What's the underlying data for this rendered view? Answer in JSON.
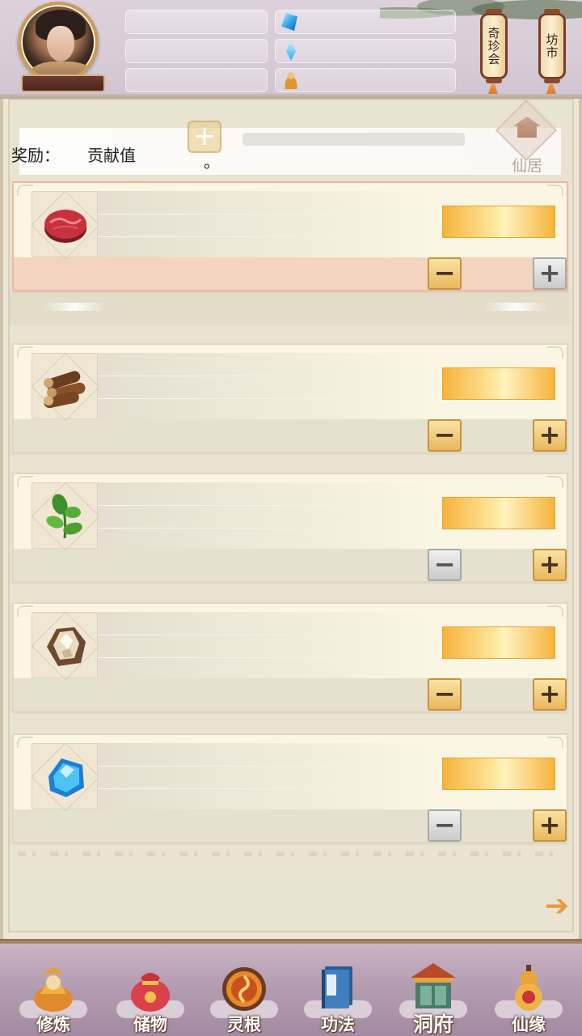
{
  "header": {
    "shortcuts": [
      {
        "label": "奇珍会"
      },
      {
        "label": "坊市"
      }
    ],
    "resources": [
      {
        "icon": "spirit-stone-icon"
      },
      {
        "icon": "spirit-crystal-icon"
      },
      {
        "icon": "cultivator-icon"
      }
    ]
  },
  "reward": {
    "label": "奖励：",
    "value": "贡献值",
    "suffix": "。",
    "home_label": "仙居"
  },
  "items": [
    {
      "name": "meat",
      "icon": "meat-icon",
      "selected": true,
      "minus_style": "gold",
      "plus_style": "grey"
    },
    {
      "name": "wood",
      "icon": "wood-logs-icon",
      "selected": false,
      "minus_style": "gold",
      "plus_style": "gold"
    },
    {
      "name": "herb",
      "icon": "herb-icon",
      "selected": false,
      "minus_style": "grey",
      "plus_style": "gold"
    },
    {
      "name": "ore",
      "icon": "ore-icon",
      "selected": false,
      "minus_style": "gold",
      "plus_style": "gold"
    },
    {
      "name": "crystal",
      "icon": "blue-crystal-icon",
      "selected": false,
      "minus_style": "grey",
      "plus_style": "gold"
    }
  ],
  "buttons": {
    "minus": "−",
    "plus": "+"
  },
  "nav": [
    {
      "label": "修炼",
      "icon": "meditation-icon"
    },
    {
      "label": "储物",
      "icon": "storage-bag-icon"
    },
    {
      "label": "灵根",
      "icon": "spirit-root-icon"
    },
    {
      "label": "功法",
      "icon": "technique-book-icon"
    },
    {
      "label": "洞府",
      "icon": "cave-dwelling-icon",
      "active": true
    },
    {
      "label": "仙缘",
      "icon": "gourd-icon"
    }
  ],
  "colors": {
    "accent_gold": "#f6b33c",
    "panel_bg": "#ebe6d6",
    "selected_border": "#f0b7a3"
  }
}
